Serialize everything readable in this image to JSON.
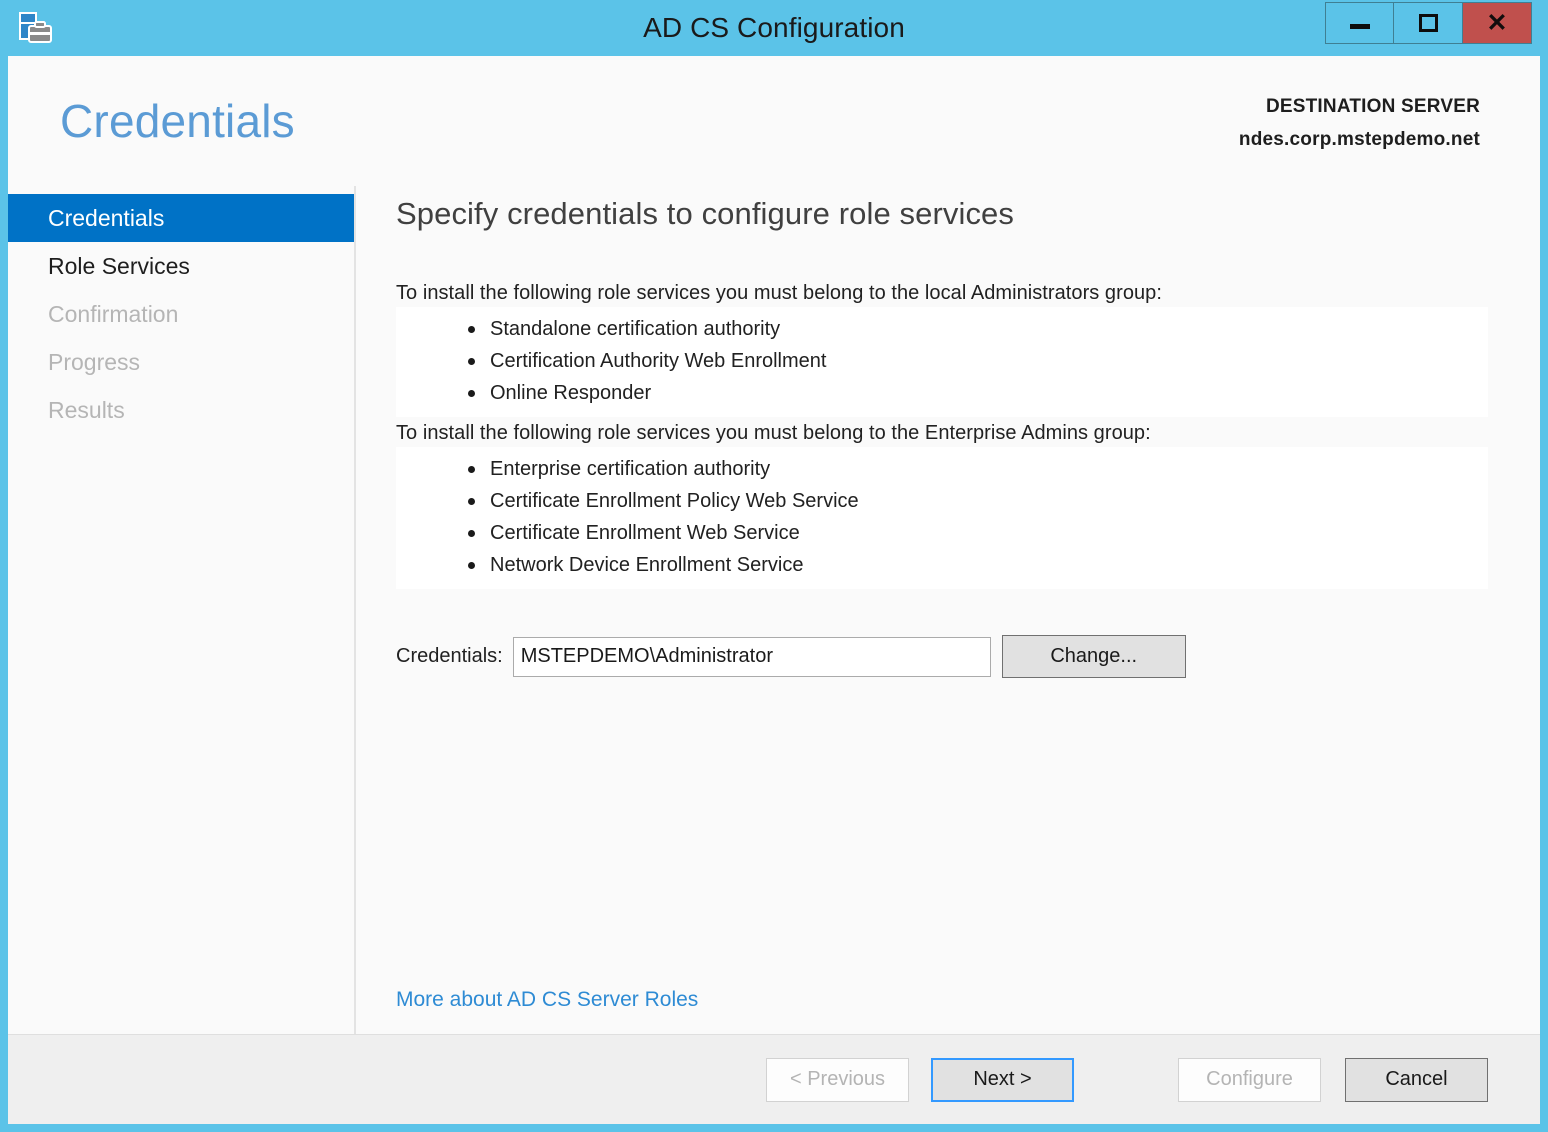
{
  "window": {
    "title": "AD CS Configuration",
    "icon": "server-toolbox-icon",
    "frame_color": "#5BC3E8",
    "controls": {
      "minimize": "minimize-icon",
      "maximize": "maximize-icon",
      "close": "close-icon",
      "close_color": "#C0504D"
    }
  },
  "header": {
    "page_title": "Credentials",
    "page_title_color": "#5B9BD5",
    "destination_label": "DESTINATION SERVER",
    "destination_server": "ndes.corp.mstepdemo.net"
  },
  "sidebar": {
    "selected_color": "#0072C6",
    "items": [
      {
        "label": "Credentials",
        "state": "selected"
      },
      {
        "label": "Role Services",
        "state": "enabled"
      },
      {
        "label": "Confirmation",
        "state": "disabled"
      },
      {
        "label": "Progress",
        "state": "disabled"
      },
      {
        "label": "Results",
        "state": "disabled"
      }
    ]
  },
  "main": {
    "heading": "Specify credentials to configure role services",
    "local_admins": {
      "intro": "To install the following role services you must belong to the local Administrators group:",
      "services": [
        "Standalone certification authority",
        "Certification Authority Web Enrollment",
        "Online Responder"
      ]
    },
    "enterprise_admins": {
      "intro": "To install the following role services you must belong to the Enterprise Admins group:",
      "services": [
        "Enterprise certification authority",
        "Certificate Enrollment Policy Web Service",
        "Certificate Enrollment Web Service",
        "Network Device Enrollment Service"
      ]
    },
    "credentials": {
      "label": "Credentials:",
      "value": "MSTEPDEMO\\Administrator",
      "placeholder": "",
      "change_button": "Change..."
    },
    "more_link": "More about AD CS Server Roles",
    "link_color": "#2E8BD4"
  },
  "footer": {
    "previous": "< Previous",
    "next": "Next >",
    "configure": "Configure",
    "cancel": "Cancel"
  }
}
